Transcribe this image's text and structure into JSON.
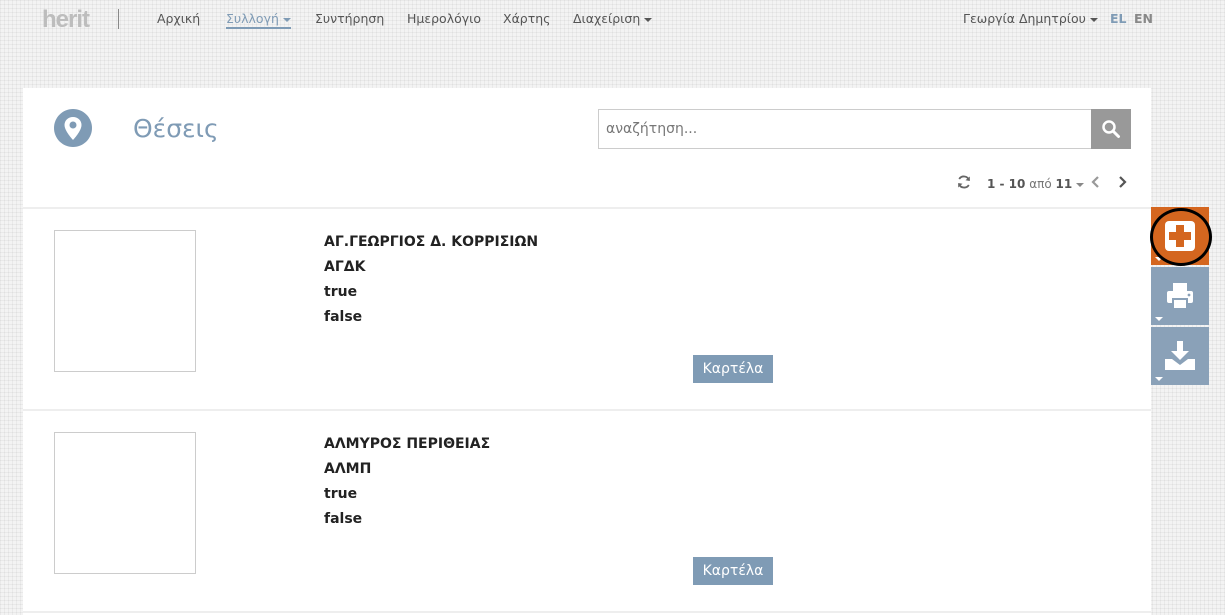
{
  "nav": {
    "logo": "herit",
    "items": [
      {
        "label": "Αρχική"
      },
      {
        "label": "Συλλογή"
      },
      {
        "label": "Συντήρηση"
      },
      {
        "label": "Ημερολόγιο"
      },
      {
        "label": "Χάρτης"
      },
      {
        "label": "Διαχείριση"
      }
    ],
    "user": "Γεωργία Δημητρίου",
    "lang_el": "EL",
    "lang_en": "EN"
  },
  "page": {
    "title": "Θέσεις",
    "icon": "map-pin-icon"
  },
  "search": {
    "placeholder": "αναζήτηση...",
    "value": ""
  },
  "pager": {
    "range": "1 - 10",
    "of": "από",
    "total": "11"
  },
  "rows": [
    {
      "name": "ΑΓ.ΓΕΩΡΓΙΟΣ Δ. ΚΟΡΡΙΣΙΩΝ",
      "code": "ΑΓΔΚ",
      "flag1": "true",
      "flag2": "false",
      "button": "Καρτέλα"
    },
    {
      "name": "ΑΛΜΥΡΟΣ ΠΕΡΙΘΕΙΑΣ",
      "code": "ΑΛΜΠ",
      "flag1": "true",
      "flag2": "false",
      "button": "Καρτέλα"
    }
  ],
  "colors": {
    "accent": "#7f9bb5",
    "add": "#d4661f",
    "side": "#8aa1b8"
  }
}
